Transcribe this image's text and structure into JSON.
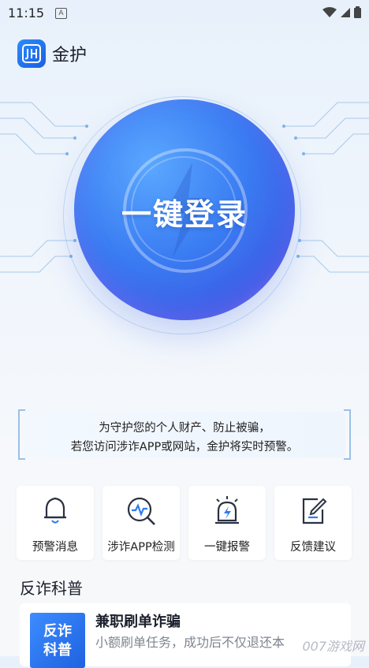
{
  "status_bar": {
    "time": "11:15",
    "a_badge": "A"
  },
  "header": {
    "title": "金护",
    "logo_text": "JH"
  },
  "hero": {
    "login_label": "一键登录"
  },
  "notice": {
    "line1": "为守护您的个人财产、防止被骗，",
    "line2": "若您访问涉诈APP或网站，金护将实时预警。"
  },
  "features": [
    {
      "label": "预警消息",
      "icon": "bell-icon"
    },
    {
      "label": "涉诈APP检测",
      "icon": "scan-icon"
    },
    {
      "label": "一键报警",
      "icon": "alarm-light-icon"
    },
    {
      "label": "反馈建议",
      "icon": "feedback-edit-icon"
    }
  ],
  "section": {
    "title": "反诈科普"
  },
  "article": {
    "thumb_text_1": "反诈",
    "thumb_text_2": "科普",
    "title": "兼职刷单诈骗",
    "desc": "小额刷单任务，成功后不仅退还本"
  },
  "watermark": "007游戏网",
  "colors": {
    "accent": "#2f7bf0",
    "button_gradient_end": "#6a64e8"
  }
}
